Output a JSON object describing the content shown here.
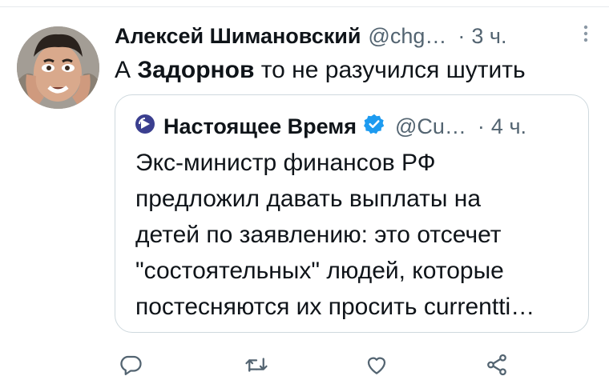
{
  "tweet": {
    "author": "Алексей Шимановский",
    "handle": "@chg…",
    "separator": "·",
    "time": "3 ч.",
    "text_prefix": "А ",
    "text_bold": "Задорнов",
    "text_suffix": " то не разучился шутить"
  },
  "quoted": {
    "author": "Настоящее Время",
    "handle": "@Cu…",
    "separator": "·",
    "time": "4 ч.",
    "lines": [
      "Экс-министр финансов РФ",
      "предложил давать выплаты на",
      "детей по заявлению: это отсечет",
      "\"состоятельных\" людей, которые",
      "постесняются их просить currentti…"
    ]
  },
  "colors": {
    "text": "#0f1419",
    "secondary": "#536471",
    "verified": "#1d9bf0",
    "brand": "#3b3f8f",
    "border": "#cfd9de"
  },
  "icons": [
    "reply-icon",
    "retweet-icon",
    "like-icon",
    "share-icon",
    "more-icon",
    "verified-icon"
  ]
}
